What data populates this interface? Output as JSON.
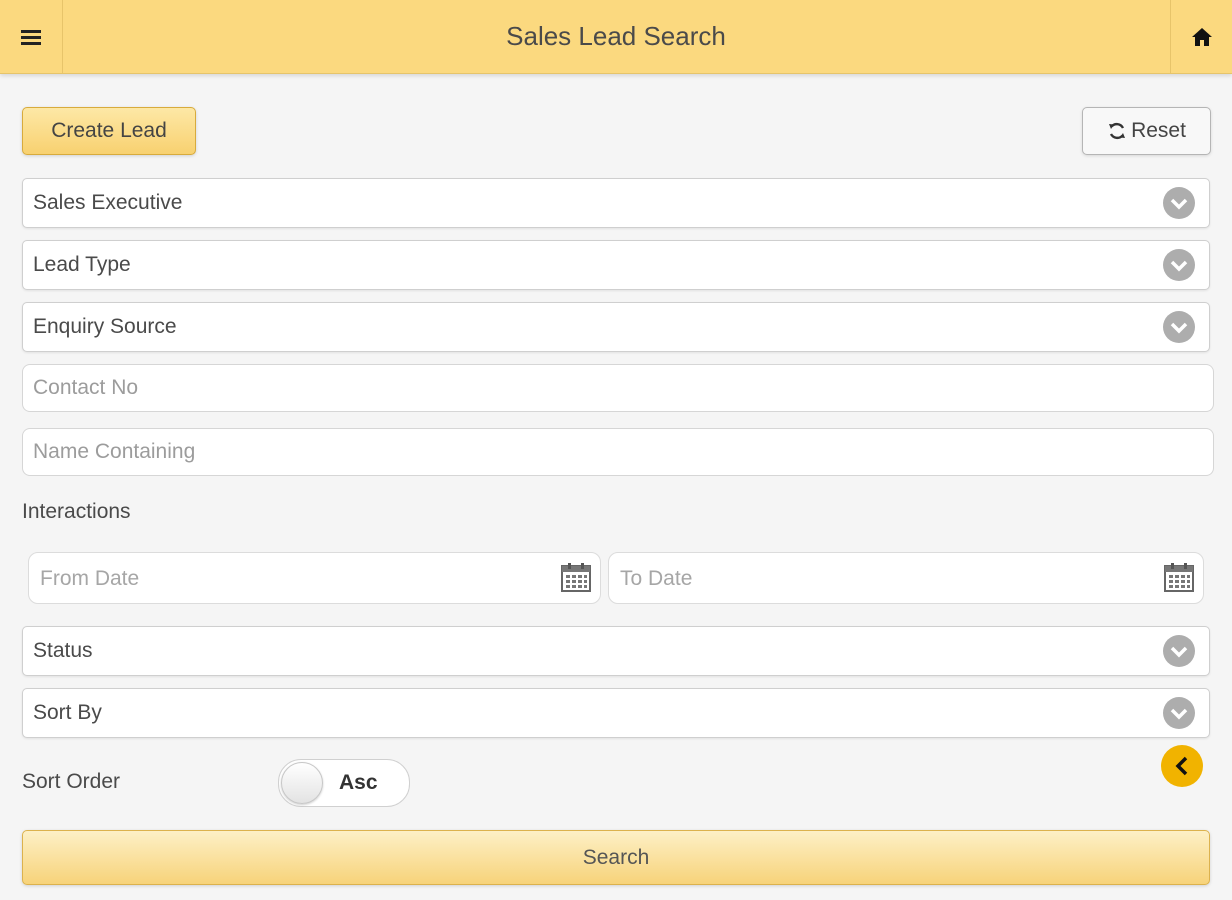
{
  "header": {
    "title": "Sales Lead Search",
    "menu_icon": "hamburger-menu-icon",
    "home_icon": "home-icon",
    "bar_color": "#fbd97f"
  },
  "actions": {
    "create_label": "Create Lead",
    "reset_label": "Reset",
    "reset_icon": "refresh-icon"
  },
  "filters": {
    "sales_executive": "Sales Executive",
    "lead_type": "Lead Type",
    "enquiry_source": "Enquiry Source",
    "contact_no_placeholder": "Contact No",
    "name_containing_placeholder": "Name Containing",
    "status": "Status",
    "sort_by": "Sort By"
  },
  "interactions": {
    "label": "Interactions",
    "from_date_placeholder": "From Date",
    "to_date_placeholder": "To Date"
  },
  "sort_order": {
    "label": "Sort Order",
    "value": "Asc"
  },
  "search_label": "Search",
  "accent_color": "#f1b300"
}
